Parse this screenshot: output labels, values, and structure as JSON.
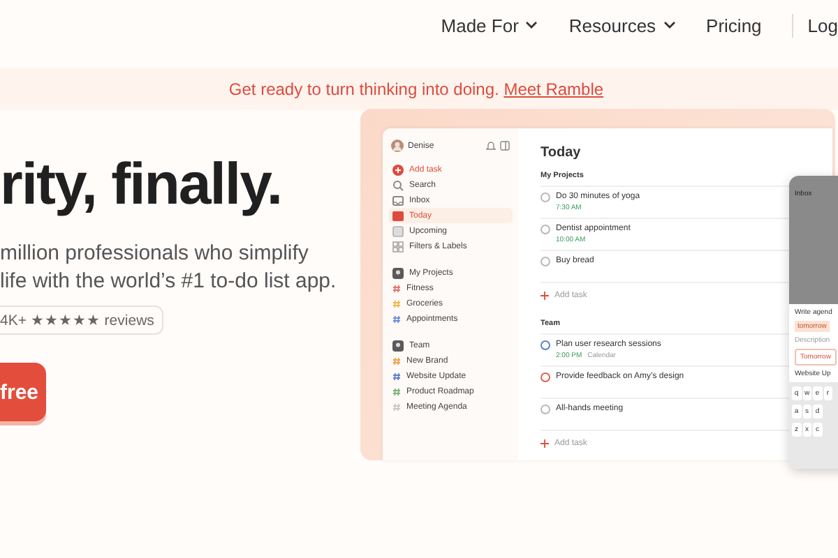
{
  "nav": {
    "links": [
      {
        "label": "Made For",
        "dropdown": true
      },
      {
        "label": "Resources",
        "dropdown": true
      },
      {
        "label": "Pricing",
        "dropdown": false
      },
      {
        "label": "Log",
        "dropdown": false
      }
    ]
  },
  "banner": {
    "text": "Get ready to turn thinking into doing.",
    "link": "Meet Ramble"
  },
  "hero": {
    "heading": "rity, finally.",
    "lines": [
      "million professionals who simplify",
      "life with the world’s #1 to-do list app."
    ],
    "reviews": "4K+ ★★★★★ reviews",
    "cta": "free"
  },
  "app": {
    "user": "Denise",
    "nav": [
      {
        "label": "Add task",
        "kind": "add",
        "selected": false
      },
      {
        "label": "Search",
        "kind": "search",
        "selected": false
      },
      {
        "label": "Inbox",
        "kind": "inbox",
        "selected": false
      },
      {
        "label": "Today",
        "kind": "today",
        "selected": true
      },
      {
        "label": "Upcoming",
        "kind": "upcoming",
        "selected": false
      },
      {
        "label": "Filters & Labels",
        "kind": "filters",
        "selected": false
      }
    ],
    "groups": [
      {
        "label": "My Projects",
        "projects": [
          {
            "label": "Fitness",
            "color": "#e8736a"
          },
          {
            "label": "Groceries",
            "color": "#f0b94a"
          },
          {
            "label": "Appointments",
            "color": "#6b8fd6"
          }
        ]
      },
      {
        "label": "Team",
        "projects": [
          {
            "label": "New Brand",
            "color": "#f0a04a"
          },
          {
            "label": "Website Update",
            "color": "#5b7fd0"
          },
          {
            "label": "Product Roadmap",
            "color": "#7bb37b"
          },
          {
            "label": "Meeting Agenda",
            "color": "#c8c8c8"
          }
        ]
      }
    ],
    "title": "Today",
    "sections": [
      {
        "label": "My Projects",
        "tasks": [
          {
            "name": "Do 30 minutes of yoga",
            "color": "#b8b8b8",
            "time": "7:30 AM"
          },
          {
            "name": "Dentist appointment",
            "color": "#b8b8b8",
            "time": "10:00 AM"
          },
          {
            "name": "Buy bread",
            "color": "#b8b8b8"
          }
        ],
        "add": "Add task"
      },
      {
        "label": "Team",
        "tasks": [
          {
            "name": "Plan user research sessions",
            "color": "#5b7fd0",
            "time": "2:00 PM",
            "extra": "Calendar"
          },
          {
            "name": "Provide feedback on Amy’s design",
            "color": "#e0624e"
          },
          {
            "name": "All-hands meeting",
            "color": "#b8b8b8"
          }
        ],
        "add": "Add task"
      }
    ]
  },
  "phone": {
    "header": "Inbox",
    "task": "Write agend",
    "tag": "tomorrow",
    "description": "Description",
    "date": "Tomorrow",
    "project": "Website Up",
    "keys": [
      [
        "q",
        "w",
        "e",
        "r"
      ],
      [
        "a",
        "s",
        "d"
      ],
      [
        "z",
        "x",
        "c"
      ]
    ]
  }
}
